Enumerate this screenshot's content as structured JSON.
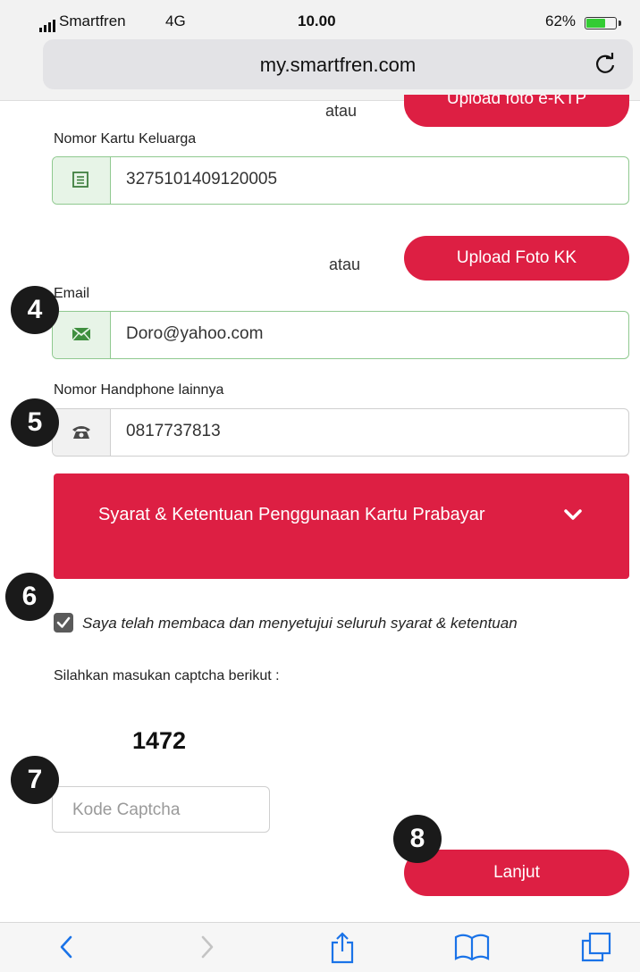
{
  "status_bar": {
    "carrier": "Smartfren",
    "network": "4G",
    "time": "10.00",
    "battery": "62%",
    "battery_level": 0.62
  },
  "browser": {
    "url": "my.smartfren.com",
    "reload_icon": "reload-icon"
  },
  "form": {
    "upload_ktp_label": "Upload foto e-KTP",
    "atau_top": "atau",
    "kk_label": "Nomor Kartu Keluarga",
    "kk_value": "3275101409120005",
    "kk_icon": "card-icon",
    "atau_kk": "atau",
    "upload_kk_label": "Upload Foto KK",
    "email_label": "Email",
    "email_value": "Doro@yahoo.com",
    "email_icon": "envelope-icon",
    "phone_label": "Nomor Handphone lainnya",
    "phone_value": "0817737813",
    "phone_icon": "phone-icon",
    "terms_title": "Syarat & Ketentuan Penggunaan Kartu Prabayar",
    "agree_text": "Saya telah membaca dan menyetujui seluruh syarat & ketentuan",
    "agree_checked": true,
    "captcha_label": "Silahkan masukan captcha berikut :",
    "captcha_code": "1472",
    "captcha_placeholder": "Kode Captcha",
    "submit_label": "Lanjut"
  },
  "step_badges": [
    "4",
    "5",
    "6",
    "7",
    "8"
  ],
  "colors": {
    "brand_red": "#dd1f43",
    "valid_green": "#8fc98f"
  },
  "toolbar": {
    "icons": [
      "back-icon",
      "forward-icon",
      "share-icon",
      "bookmarks-icon",
      "tabs-icon"
    ]
  }
}
